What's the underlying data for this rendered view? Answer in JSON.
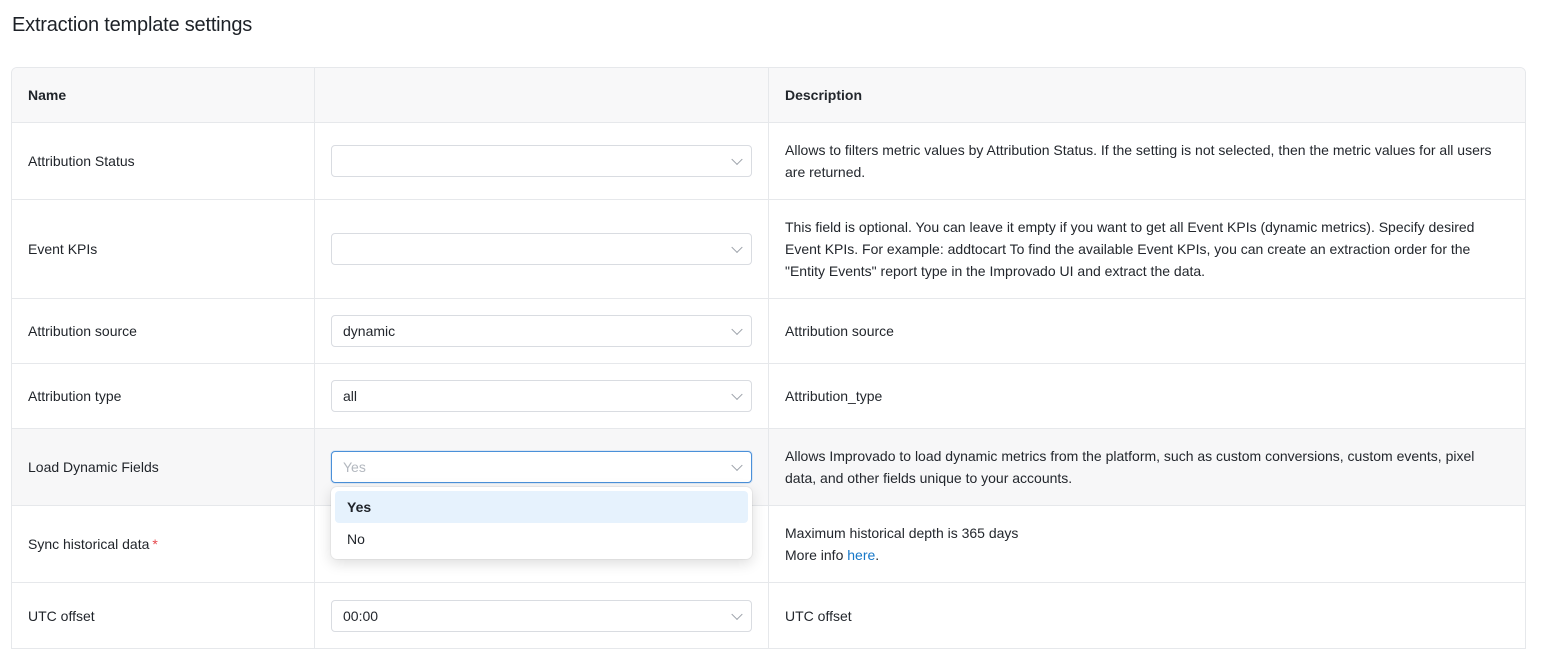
{
  "page": {
    "title": "Extraction template settings"
  },
  "table": {
    "headers": {
      "name": "Name",
      "value": "",
      "description": "Description"
    },
    "rows": {
      "attribution_status": {
        "name": "Attribution Status",
        "value": "",
        "description": "Allows to filters metric values by Attribution Status. If the setting is not selected, then the metric values for all users are returned."
      },
      "event_kpis": {
        "name": "Event KPIs",
        "value": "",
        "description": "This field is optional. You can leave it empty if you want to get all Event KPIs (dynamic metrics). Specify desired Event KPIs. For example: addtocart To find the available Event KPIs, you can create an extraction order for the \"Entity Events\" report type in the Improvado UI and extract the data."
      },
      "attribution_source": {
        "name": "Attribution source",
        "value": "dynamic",
        "description": "Attribution source"
      },
      "attribution_type": {
        "name": "Attribution type",
        "value": "all",
        "description": "Attribution_type"
      },
      "load_dynamic_fields": {
        "name": "Load Dynamic Fields",
        "placeholder": "Yes",
        "description": "Allows Improvado to load dynamic metrics from the platform, such as custom conversions, custom events, pixel data, and other fields unique to your accounts."
      },
      "sync_historical_data": {
        "name": "Sync historical data",
        "required_mark": "*",
        "description_line1": "Maximum historical depth is 365 days",
        "description_prefix": "More info ",
        "link_text": "here",
        "description_suffix": "."
      },
      "utc_offset": {
        "name": "UTC offset",
        "value": "00:00",
        "description": "UTC offset"
      }
    }
  },
  "dropdown": {
    "options": [
      "Yes",
      "No"
    ],
    "highlighted": "Yes"
  },
  "colors": {
    "accent": "#1677c8",
    "focus_border": "#4a90d9",
    "option_highlight": "#e6f2fd",
    "required": "#e5484d"
  }
}
